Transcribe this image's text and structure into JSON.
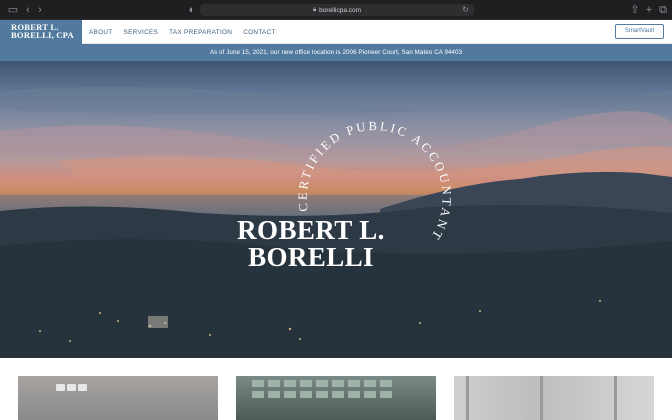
{
  "browser": {
    "url": "borellicpa.com"
  },
  "header": {
    "logo_line1": "ROBERT L.",
    "logo_line2": "BORELLI, CPA",
    "nav": [
      {
        "label": "ABOUT"
      },
      {
        "label": "SERVICES"
      },
      {
        "label": "TAX PREPARATION"
      },
      {
        "label": "CONTACT"
      }
    ],
    "smartvault_label": "SmartVault"
  },
  "announcement": {
    "text": "As of June 15, 2021, our new office location is 2006 Pioneer Court, San Mateo CA 94403"
  },
  "hero": {
    "arc_text": "CERTIFIED PUBLIC ACCOUNTANT",
    "title_line1": "ROBERT L.",
    "title_line2": "BORELLI"
  },
  "colors": {
    "brand_blue": "#517a9e",
    "nav_text": "#3f5f7c",
    "chrome_bg": "#1f1f21"
  },
  "icons": {
    "sidebar": "sidebar-icon",
    "back": "chevron-left-icon",
    "forward": "chevron-right-icon",
    "privacy": "shield-icon",
    "lock": "lock-icon",
    "reload": "reload-icon",
    "share": "share-icon",
    "new_tab": "plus-icon",
    "tabs": "tabs-icon"
  }
}
